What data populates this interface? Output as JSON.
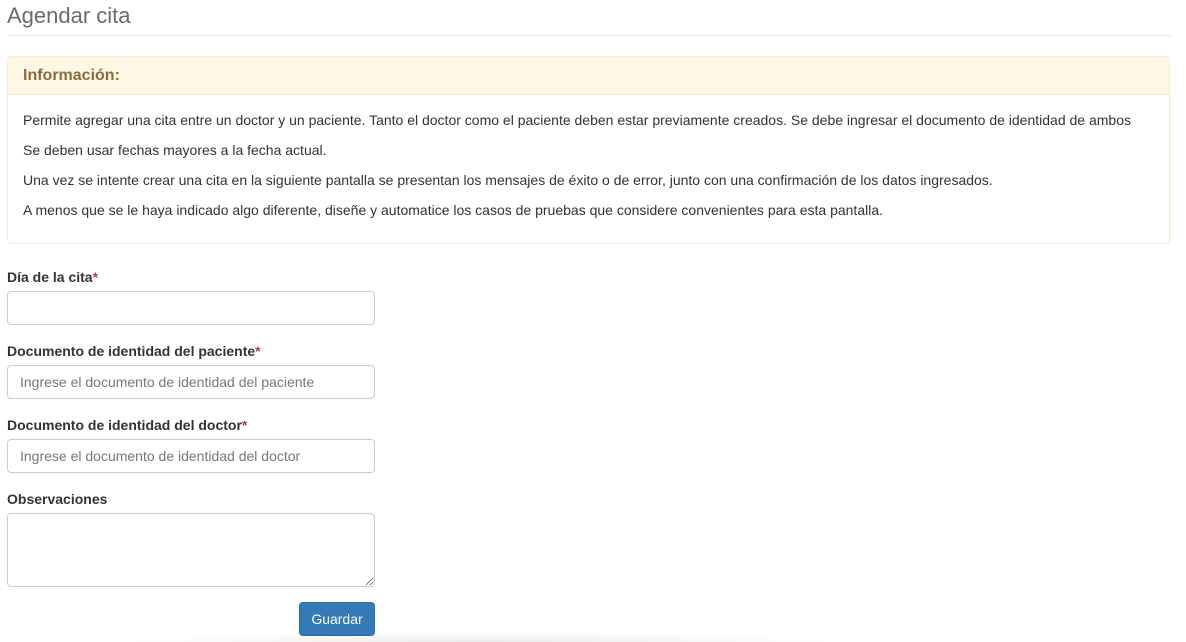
{
  "page": {
    "title": "Agendar cita"
  },
  "info": {
    "heading": "Información:",
    "paragraphs": [
      "Permite agregar una cita entre un doctor y un paciente. Tanto el doctor como el paciente deben estar previamente creados. Se debe ingresar el documento de identidad de ambos",
      "Se deben usar fechas mayores a la fecha actual.",
      "Una vez se intente crear una cita en la siguiente pantalla se presentan los mensajes de éxito o de error, junto con una confirmación de los datos ingresados.",
      "A menos que se le haya indicado algo diferente, diseñe y automatice los casos de pruebas que considere convenientes para esta pantalla."
    ]
  },
  "form": {
    "required_mark": "*",
    "date": {
      "label": "Día de la cita",
      "value": ""
    },
    "patient": {
      "label": "Documento de identidad del paciente",
      "placeholder": "Ingrese el documento de identidad del paciente",
      "value": ""
    },
    "doctor": {
      "label": "Documento de identidad del doctor",
      "placeholder": "Ingrese el documento de identidad del doctor",
      "value": ""
    },
    "notes": {
      "label": "Observaciones",
      "value": ""
    },
    "submit_label": "Guardar"
  },
  "colors": {
    "info_heading_bg": "#fcf8e3",
    "info_heading_text": "#8a6d3b",
    "info_border": "#faebcc",
    "required": "#a94442",
    "primary_button": "#337ab7"
  }
}
